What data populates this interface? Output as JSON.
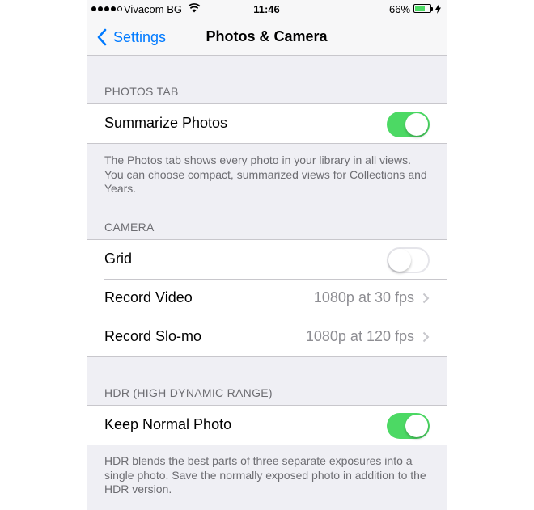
{
  "status_bar": {
    "carrier": "Vivacom BG",
    "time": "11:46",
    "battery_percent": "66%",
    "battery_level": 0.66,
    "signal_bars": 4,
    "signal_total": 5,
    "accent_battery": "#4cd964"
  },
  "nav": {
    "back_label": "Settings",
    "title": "Photos & Camera"
  },
  "photos_tab": {
    "header": "PHOTOS TAB",
    "summarize_label": "Summarize Photos",
    "summarize_on": true,
    "footer": "The Photos tab shows every photo in your library in all views. You can choose compact, summarized views for Collections and Years."
  },
  "camera": {
    "header": "CAMERA",
    "grid_label": "Grid",
    "grid_on": false,
    "record_video_label": "Record Video",
    "record_video_value": "1080p at 30 fps",
    "record_slomo_label": "Record Slo-mo",
    "record_slomo_value": "1080p at 120 fps"
  },
  "hdr": {
    "header": "HDR (HIGH DYNAMIC RANGE)",
    "keep_normal_label": "Keep Normal Photo",
    "keep_normal_on": true,
    "footer": "HDR blends the best parts of three separate exposures into a single photo. Save the normally exposed photo in addition to the HDR version."
  },
  "colors": {
    "tint": "#007aff",
    "toggle_on": "#4cd964",
    "background": "#efeff4"
  }
}
